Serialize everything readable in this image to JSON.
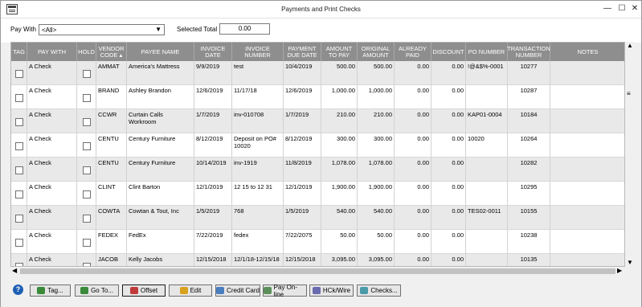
{
  "window": {
    "title": "Payments and Print Checks"
  },
  "filters": {
    "pay_with_label": "Pay With",
    "pay_with_value": "<All>",
    "selected_total_label": "Selected Total",
    "selected_total_value": "0.00"
  },
  "columns": [
    "TAG",
    "PAY WITH",
    "HOLD",
    "VENDOR CODE ▴",
    "PAYEE NAME",
    "INVOICE DATE",
    "INVOICE NUMBER",
    "PAYMENT DUE DATE",
    "AMOUNT TO PAY",
    "ORIGINAL AMOUNT",
    "ALREADY PAID",
    "DISCOUNT",
    "PO NUMBER",
    "TRANSACTION NUMBER",
    "NOTES"
  ],
  "rows": [
    {
      "pay_with": "A Check",
      "vendor": "AMMAT",
      "payee": "America's Mattress",
      "inv_date": "9/9/2019",
      "inv_num": "test",
      "due": "10/4/2019",
      "amount": "500.00",
      "original": "500.00",
      "paid": "0.00",
      "discount": "0.00",
      "po": "!@&$%-0001",
      "trans": "10277",
      "notes": ""
    },
    {
      "pay_with": "A Check",
      "vendor": "BRAND",
      "payee": "Ashley Brandon",
      "inv_date": "12/6/2019",
      "inv_num": "11/17/18",
      "due": "12/6/2019",
      "amount": "1,000.00",
      "original": "1,000.00",
      "paid": "0.00",
      "discount": "0.00",
      "po": "",
      "trans": "10287",
      "notes": ""
    },
    {
      "pay_with": "A Check",
      "vendor": "CCWR",
      "payee": "Curtain Calls Workroom",
      "inv_date": "1/7/2019",
      "inv_num": "inv-010708",
      "due": "1/7/2019",
      "amount": "210.00",
      "original": "210.00",
      "paid": "0.00",
      "discount": "0.00",
      "po": "KAP01-0004",
      "trans": "10184",
      "notes": ""
    },
    {
      "pay_with": "A Check",
      "vendor": "CENTU",
      "payee": "Century Furniture",
      "inv_date": "8/12/2019",
      "inv_num": "Deposit on PO# 10020",
      "due": "8/12/2019",
      "amount": "300.00",
      "original": "300.00",
      "paid": "0.00",
      "discount": "0.00",
      "po": "10020",
      "trans": "10264",
      "notes": ""
    },
    {
      "pay_with": "A Check",
      "vendor": "CENTU",
      "payee": "Century Furniture",
      "inv_date": "10/14/2019",
      "inv_num": "inv-1919",
      "due": "11/8/2019",
      "amount": "1,078.00",
      "original": "1,078.00",
      "paid": "0.00",
      "discount": "0.00",
      "po": "",
      "trans": "10282",
      "notes": ""
    },
    {
      "pay_with": "A Check",
      "vendor": "CLINT",
      "payee": "Clint Barton",
      "inv_date": "12/1/2019",
      "inv_num": "12 15  to 12 31",
      "due": "12/1/2019",
      "amount": "1,900.00",
      "original": "1,900.00",
      "paid": "0.00",
      "discount": "0.00",
      "po": "",
      "trans": "10295",
      "notes": ""
    },
    {
      "pay_with": "A Check",
      "vendor": "COWTA",
      "payee": "Cowtan & Tout, Inc",
      "inv_date": "1/5/2019",
      "inv_num": "768",
      "due": "1/5/2019",
      "amount": "540.00",
      "original": "540.00",
      "paid": "0.00",
      "discount": "0.00",
      "po": "TES02-0011",
      "trans": "10155",
      "notes": ""
    },
    {
      "pay_with": "A Check",
      "vendor": "FEDEX",
      "payee": "FedEx",
      "inv_date": "7/22/2019",
      "inv_num": "fedex",
      "due": "7/22/2075",
      "amount": "50.00",
      "original": "50.00",
      "paid": "0.00",
      "discount": "0.00",
      "po": "",
      "trans": "10238",
      "notes": ""
    },
    {
      "pay_with": "A Check",
      "vendor": "JACOB",
      "payee": "Kelly Jacobs",
      "inv_date": "12/15/2018",
      "inv_num": "12/1/18-12/15/18",
      "due": "12/15/2018",
      "amount": "3,095.00",
      "original": "3,095.00",
      "paid": "0.00",
      "discount": "0.00",
      "po": "",
      "trans": "10135",
      "notes": ""
    }
  ],
  "buttons": {
    "tag": "Tag...",
    "goto": "Go To...",
    "offset": "Offset",
    "edit": "Edit",
    "credit_card": "Credit Card",
    "pay_online": "Pay On-line",
    "hck_wire": "HCk/Wire",
    "checks": "Checks..."
  }
}
